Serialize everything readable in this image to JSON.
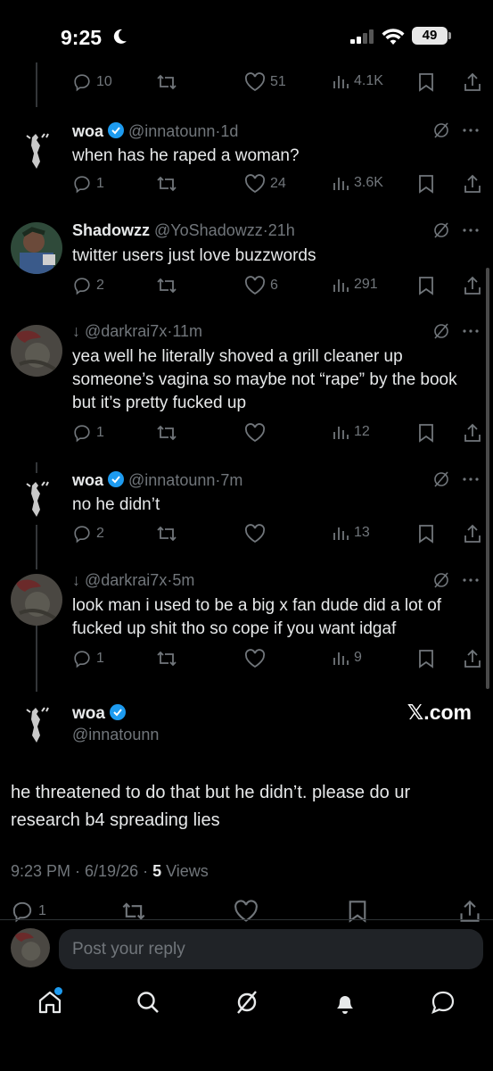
{
  "status_bar": {
    "time": "9:25",
    "battery": "49"
  },
  "top_tweet_actions": {
    "replies": "10",
    "retweets": "",
    "likes": "51",
    "views": "4.1K"
  },
  "replies": [
    {
      "name": "woa",
      "verified": true,
      "handle": "@innatounn",
      "time": "1d",
      "text": "when has he raped a woman?",
      "replies": "1",
      "likes": "24",
      "views": "3.6K"
    },
    {
      "name": "Shadowzz",
      "verified": false,
      "handle": "@YoShadowzz",
      "time": "21h",
      "text": "twitter users just love buzzwords",
      "replies": "2",
      "likes": "6",
      "views": "291"
    },
    {
      "name": "↓",
      "verified": false,
      "handle": "@darkrai7x",
      "time": "11m",
      "text": "yea well he literally shoved a grill cleaner up someone’s vagina so maybe not “rape” by the book but it’s pretty fucked up",
      "replies": "1",
      "likes": "",
      "views": "12"
    },
    {
      "name": "woa",
      "verified": true,
      "handle": "@innatounn",
      "time": "7m",
      "text": "no he didn’t",
      "replies": "2",
      "likes": "",
      "views": "13"
    },
    {
      "name": "↓",
      "verified": false,
      "handle": "@darkrai7x",
      "time": "5m",
      "text": "look man i used to be a big x fan dude did a lot of fucked up shit tho so cope if you want idgaf",
      "replies": "1",
      "likes": "",
      "views": "9"
    }
  ],
  "focused": {
    "name": "woa",
    "handle": "@innatounn",
    "brand": "𝕏.com",
    "text": "he threatened to do that but he didn’t. please do ur research b4 spreading lies",
    "timestamp": "9:23 PM · 6/19/26 · ",
    "views_count": "5",
    "views_label": " Views",
    "replies": "1"
  },
  "reply_box": {
    "placeholder": "Post your reply"
  },
  "colors": {
    "accent": "#1d9bf0",
    "muted": "#71767b",
    "text": "#e7e9ea",
    "background": "#000000"
  },
  "icons": [
    "moon-icon",
    "signal-icon",
    "wifi-icon",
    "reply-icon",
    "retweet-icon",
    "like-icon",
    "views-icon",
    "bookmark-icon",
    "share-icon",
    "grok-icon",
    "more-icon",
    "home-icon",
    "search-icon",
    "notifications-icon",
    "messages-icon"
  ]
}
